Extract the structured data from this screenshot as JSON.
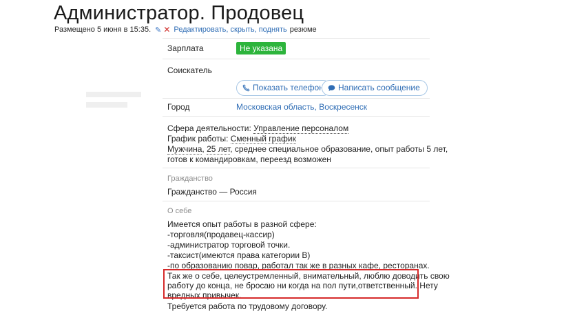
{
  "header": {
    "title": "Администратор. Продовец",
    "posted": "Размещено 5 июня в 15:35.",
    "edit_link": "Редактировать, скрыть, поднять",
    "edit_suffix": "резюме"
  },
  "fields": {
    "salary_label": "Зарплата",
    "salary_value": "Не указана",
    "applicant_label": "Соискатель",
    "show_phone": "Показать телефон",
    "write_message": "Написать сообщение",
    "city_label": "Город",
    "city_value": "Московская область, Воскресенск"
  },
  "details": {
    "sphere_label": "Сфера деятельности:",
    "sphere_value": "Управление персоналом",
    "schedule_label": "График работы:",
    "schedule_value": "Сменный график",
    "gender": "Мужчина",
    "sep1": ", ",
    "age": "25 лет",
    "rest_line": ", среднее специальное образование, опыт работы 5 лет,",
    "line2": "готов к командировкам, переезд возможен"
  },
  "citizenship": {
    "caption": "Гражданство",
    "value": "Гражданство — Россия"
  },
  "about": {
    "caption": "О себе",
    "lines": [
      "Имеется опыт работы в разной сфере:",
      "-торговля(продавец-кассир)",
      "-администратор торговой точки.",
      "-таксист(имеются права категории B)",
      "-по образованию повар, работал так же в разных кафе, ресторанах.",
      "Так же о себе, целеустремленный, внимательный, люблю доводить свою",
      "работу до конца, не бросаю ни когда на пол пути,ответственный. Нету",
      "вредных привычек.",
      "Требуется работа по трудовому договору."
    ]
  },
  "colors": {
    "accent_link": "#2f6db5",
    "salary_badge": "#2db43c",
    "highlight_border": "#d62a2a"
  }
}
